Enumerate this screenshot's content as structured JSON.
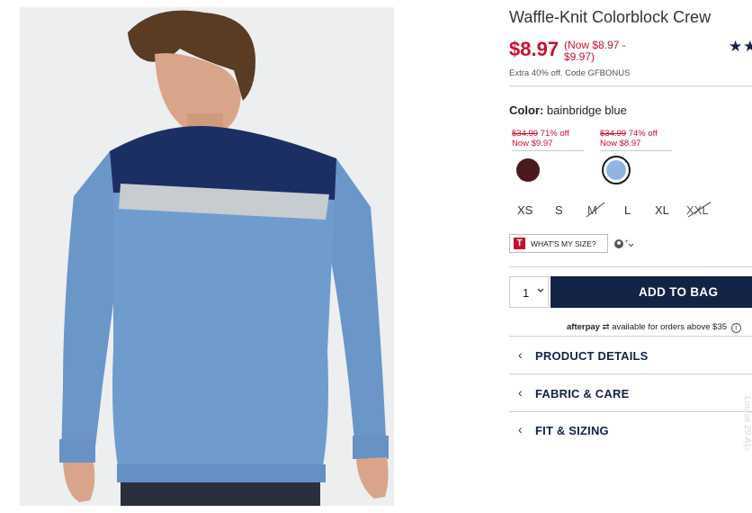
{
  "product": {
    "title": "Waffle-Knit Colorblock Crew",
    "price": "$8.97",
    "price_range": "(Now $8.97 - $9.97)",
    "rating_stars": "★★",
    "promo": "Extra 40% off. Code GFBONUS"
  },
  "color": {
    "label": "Color:",
    "value": "bainbridge blue",
    "swatches": [
      {
        "was": "$34.99",
        "off": "71% off",
        "now": "Now $9.97",
        "hex": "#4a1a1e",
        "selected": false
      },
      {
        "was": "$34.99",
        "off": "74% off",
        "now": "Now $8.97",
        "hex": "#8fb5de",
        "selected": true
      }
    ]
  },
  "sizes": [
    {
      "label": "XS",
      "available": true
    },
    {
      "label": "S",
      "available": true
    },
    {
      "label": "M",
      "available": false
    },
    {
      "label": "L",
      "available": true
    },
    {
      "label": "XL",
      "available": true
    },
    {
      "label": "XXL",
      "available": false
    }
  ],
  "size_tool": {
    "badge": "T",
    "label": "WHAT'S MY SIZE?"
  },
  "purchase": {
    "quantity": "1",
    "add_to_bag": "ADD TO BAG"
  },
  "afterpay": {
    "brand": "afterpay",
    "text": "available for orders above $35",
    "info": "i"
  },
  "accordions": [
    {
      "label": "PRODUCT DETAILS"
    },
    {
      "label": "FABRIC & CARE"
    },
    {
      "label": "FIT & SIZING"
    }
  ],
  "watermark": "Louise 29 Alp",
  "colors": {
    "brand_navy": "#122344",
    "sale_red": "#c8102e"
  }
}
